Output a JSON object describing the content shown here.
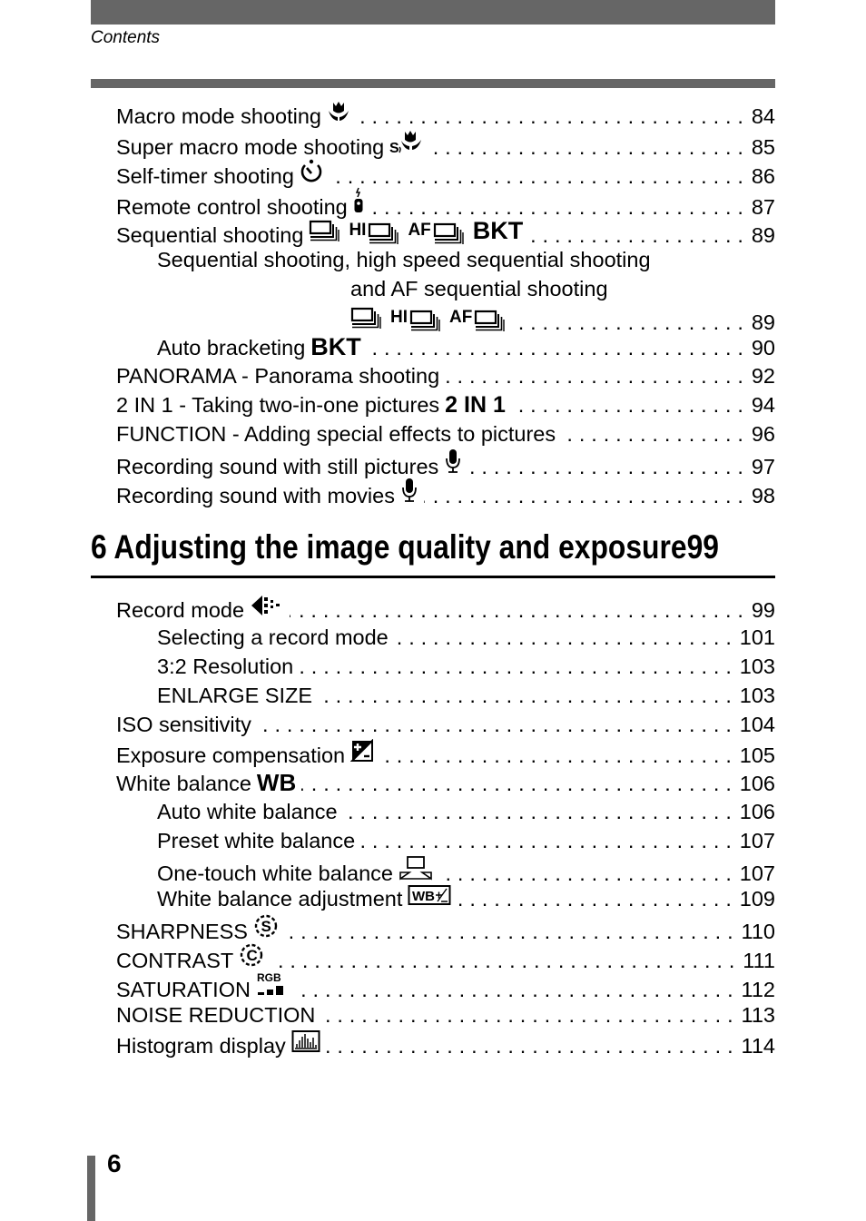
{
  "header": {
    "label": "Contents"
  },
  "toc_part1": [
    {
      "text": "Macro mode shooting",
      "icons": [
        "macro-icon"
      ],
      "page": "84",
      "level": 1
    },
    {
      "text": "Super macro mode shooting",
      "icons": [
        "super-macro-icon"
      ],
      "page": "85",
      "level": 1
    },
    {
      "text": "Self-timer shooting",
      "icons": [
        "self-timer-icon"
      ],
      "page": "86",
      "level": 1
    },
    {
      "text": "Remote control shooting",
      "icons": [
        "remote-control-icon"
      ],
      "page": "87",
      "level": 1
    },
    {
      "text": "Sequential shooting",
      "icons": [
        "sequential-icon",
        "hi-sequential-icon",
        "af-sequential-icon",
        "bkt-icon"
      ],
      "page": "89",
      "level": 1
    },
    {
      "text": "Sequential shooting, high speed sequential shooting",
      "continuation": "and AF sequential shooting",
      "icons": [
        "sequential-icon",
        "hi-sequential-icon",
        "af-sequential-icon"
      ],
      "page": "89",
      "level": 2
    },
    {
      "text": "Auto bracketing",
      "icons": [
        "bkt-icon"
      ],
      "page": "90",
      "level": 2
    },
    {
      "text": "PANORAMA - Panorama shooting",
      "icons": [],
      "page": "92",
      "level": 1
    },
    {
      "text": "2 IN 1 - Taking two-in-one pictures",
      "icons": [
        "2in1-icon"
      ],
      "page": "94",
      "level": 1
    },
    {
      "text": "FUNCTION - Adding special effects to pictures",
      "icons": [],
      "page": "96",
      "level": 1
    },
    {
      "text": "Recording sound with still pictures",
      "icons": [
        "microphone-icon"
      ],
      "page": "97",
      "level": 1
    },
    {
      "text": "Recording sound with movies",
      "icons": [
        "microphone-icon"
      ],
      "page": "98",
      "level": 1
    }
  ],
  "icon_labels": {
    "hi": "HI",
    "af": "AF",
    "bkt": "BKT",
    "two_in_one": "2 IN 1",
    "wb": "WB",
    "rgb": "RGB",
    "wb_adj": "WB"
  },
  "section": {
    "number": "6",
    "title": "Adjusting the image quality and exposure",
    "page": "99"
  },
  "toc_part2": [
    {
      "text": "Record mode",
      "icons": [
        "record-mode-icon"
      ],
      "page": "99",
      "level": 1
    },
    {
      "text": "Selecting a record mode",
      "icons": [],
      "page": "101",
      "level": 2
    },
    {
      "text": "3:2 Resolution",
      "icons": [],
      "page": "103",
      "level": 2
    },
    {
      "text": "ENLARGE SIZE",
      "icons": [],
      "page": "103",
      "level": 2
    },
    {
      "text": "ISO sensitivity",
      "icons": [],
      "page": "104",
      "level": 1
    },
    {
      "text": "Exposure compensation",
      "icons": [
        "exposure-compensation-icon"
      ],
      "page": "105",
      "level": 1
    },
    {
      "text": "White balance",
      "icons": [
        "wb-icon"
      ],
      "page": "106",
      "level": 1
    },
    {
      "text": "Auto white balance",
      "icons": [],
      "page": "106",
      "level": 2
    },
    {
      "text": "Preset white balance",
      "icons": [],
      "page": "107",
      "level": 2
    },
    {
      "text": "One-touch white balance",
      "icons": [
        "one-touch-wb-icon"
      ],
      "page": "107",
      "level": 2
    },
    {
      "text": "White balance adjustment",
      "icons": [
        "wb-adjust-icon"
      ],
      "page": "109",
      "level": 2
    },
    {
      "text": "SHARPNESS",
      "icons": [
        "sharpness-icon"
      ],
      "page": "110",
      "level": 1
    },
    {
      "text": "CONTRAST",
      "icons": [
        "contrast-icon"
      ],
      "page": "111",
      "level": 1
    },
    {
      "text": "SATURATION",
      "icons": [
        "saturation-icon"
      ],
      "page": "112",
      "level": 1
    },
    {
      "text": "NOISE REDUCTION",
      "icons": [],
      "page": "113",
      "level": 1
    },
    {
      "text": "Histogram display",
      "icons": [
        "histogram-icon"
      ],
      "page": "114",
      "level": 1
    }
  ],
  "footer": {
    "page_number": "6"
  },
  "colors": {
    "bar_gray": "#666666",
    "text": "#000000"
  }
}
